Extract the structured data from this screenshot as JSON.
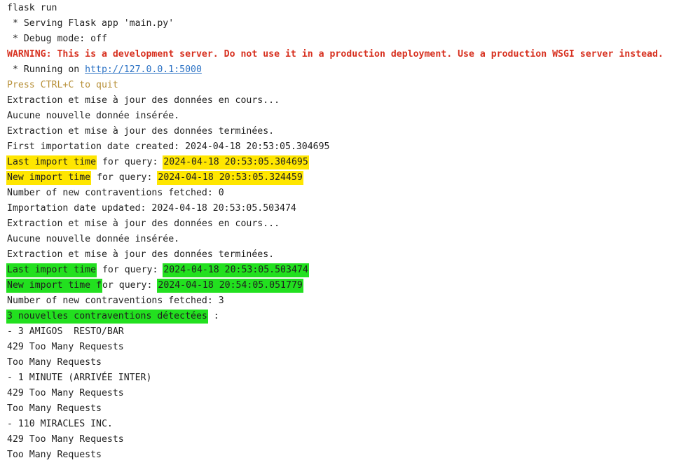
{
  "lines": [
    {
      "segments": [
        {
          "text": "flask run"
        }
      ]
    },
    {
      "segments": [
        {
          "text": " * Serving Flask app 'main.py'"
        }
      ]
    },
    {
      "segments": [
        {
          "text": " * Debug mode: off"
        }
      ]
    },
    {
      "segments": [
        {
          "text": "WARNING: This is a development server. Do not use it in a production deployment. Use a production WSGI server instead.",
          "style": "warn"
        }
      ]
    },
    {
      "segments": [
        {
          "text": " * Running on "
        },
        {
          "text": "http://127.0.0.1:5000",
          "style": "link"
        }
      ]
    },
    {
      "segments": [
        {
          "text": "Press CTRL+C to quit",
          "style": "quit"
        }
      ]
    },
    {
      "segments": [
        {
          "text": "Extraction et mise à jour des données en cours..."
        }
      ]
    },
    {
      "segments": [
        {
          "text": "Aucune nouvelle donnée insérée."
        }
      ]
    },
    {
      "segments": [
        {
          "text": "Extraction et mise à jour des données terminées."
        }
      ]
    },
    {
      "segments": [
        {
          "text": "First importation date created: 2024-04-18 20:53:05.304695"
        }
      ]
    },
    {
      "segments": [
        {
          "text": "Last import time",
          "style": "hl-y"
        },
        {
          "text": " for query: "
        },
        {
          "text": "2024-04-18 20:53:05.304695",
          "style": "hl-y"
        }
      ]
    },
    {
      "segments": [
        {
          "text": "New import time",
          "style": "hl-y"
        },
        {
          "text": " for query: "
        },
        {
          "text": "2024-04-18 20:53:05.324459",
          "style": "hl-y"
        }
      ]
    },
    {
      "segments": [
        {
          "text": "Number of new contraventions fetched: 0"
        }
      ]
    },
    {
      "segments": [
        {
          "text": "Importation date updated: 2024-04-18 20:53:05.503474"
        }
      ]
    },
    {
      "segments": [
        {
          "text": "Extraction et mise à jour des données en cours..."
        }
      ]
    },
    {
      "segments": [
        {
          "text": "Aucune nouvelle donnée insérée."
        }
      ]
    },
    {
      "segments": [
        {
          "text": "Extraction et mise à jour des données terminées."
        }
      ]
    },
    {
      "segments": [
        {
          "text": "Last import time",
          "style": "hl-g"
        },
        {
          "text": " for query: "
        },
        {
          "text": "2024-04-18 20:53:05.503474",
          "style": "hl-g"
        }
      ]
    },
    {
      "segments": [
        {
          "text": "New import time f",
          "style": "hl-g"
        },
        {
          "text": "or query: "
        },
        {
          "text": "2024-04-18 20:54:05.051779",
          "style": "hl-g"
        }
      ]
    },
    {
      "segments": [
        {
          "text": "Number of new contraventions fetched: 3"
        }
      ]
    },
    {
      "segments": [
        {
          "text": "3 nouvelles contraventions détectées",
          "style": "hl-g"
        },
        {
          "text": " :"
        }
      ]
    },
    {
      "segments": [
        {
          "text": "- 3 AMIGOS  RESTO/BAR"
        }
      ]
    },
    {
      "segments": [
        {
          "text": "429 Too Many Requests"
        }
      ]
    },
    {
      "segments": [
        {
          "text": "Too Many Requests"
        }
      ]
    },
    {
      "segments": [
        {
          "text": "- 1 MINUTE (ARRIVÉE INTER)"
        }
      ]
    },
    {
      "segments": [
        {
          "text": "429 Too Many Requests"
        }
      ]
    },
    {
      "segments": [
        {
          "text": "Too Many Requests"
        }
      ]
    },
    {
      "segments": [
        {
          "text": "- 110 MIRACLES INC."
        }
      ]
    },
    {
      "segments": [
        {
          "text": "429 Too Many Requests"
        }
      ]
    },
    {
      "segments": [
        {
          "text": "Too Many Requests"
        }
      ]
    }
  ],
  "colors": {
    "text": "#1f1f1f",
    "warning": "#d7301f",
    "quit_hint": "#b8913a",
    "link": "#2d73c5",
    "highlight_yellow": "#ffe600",
    "highlight_green": "#22e01f"
  }
}
